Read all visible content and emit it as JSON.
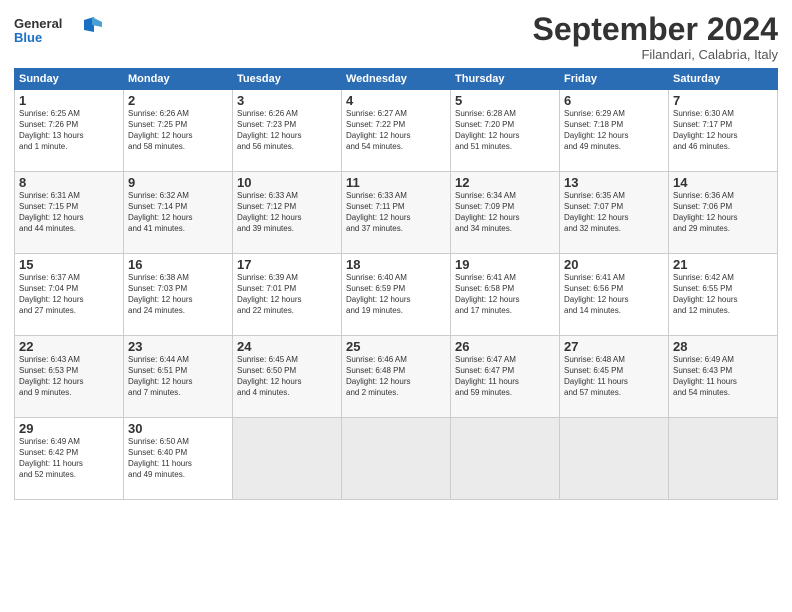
{
  "header": {
    "logo_general": "General",
    "logo_blue": "Blue",
    "month_title": "September 2024",
    "location": "Filandari, Calabria, Italy"
  },
  "weekdays": [
    "Sunday",
    "Monday",
    "Tuesday",
    "Wednesday",
    "Thursday",
    "Friday",
    "Saturday"
  ],
  "weeks": [
    [
      {
        "day": "1",
        "info": "Sunrise: 6:25 AM\nSunset: 7:26 PM\nDaylight: 13 hours\nand 1 minute."
      },
      {
        "day": "2",
        "info": "Sunrise: 6:26 AM\nSunset: 7:25 PM\nDaylight: 12 hours\nand 58 minutes."
      },
      {
        "day": "3",
        "info": "Sunrise: 6:26 AM\nSunset: 7:23 PM\nDaylight: 12 hours\nand 56 minutes."
      },
      {
        "day": "4",
        "info": "Sunrise: 6:27 AM\nSunset: 7:22 PM\nDaylight: 12 hours\nand 54 minutes."
      },
      {
        "day": "5",
        "info": "Sunrise: 6:28 AM\nSunset: 7:20 PM\nDaylight: 12 hours\nand 51 minutes."
      },
      {
        "day": "6",
        "info": "Sunrise: 6:29 AM\nSunset: 7:18 PM\nDaylight: 12 hours\nand 49 minutes."
      },
      {
        "day": "7",
        "info": "Sunrise: 6:30 AM\nSunset: 7:17 PM\nDaylight: 12 hours\nand 46 minutes."
      }
    ],
    [
      {
        "day": "8",
        "info": "Sunrise: 6:31 AM\nSunset: 7:15 PM\nDaylight: 12 hours\nand 44 minutes."
      },
      {
        "day": "9",
        "info": "Sunrise: 6:32 AM\nSunset: 7:14 PM\nDaylight: 12 hours\nand 41 minutes."
      },
      {
        "day": "10",
        "info": "Sunrise: 6:33 AM\nSunset: 7:12 PM\nDaylight: 12 hours\nand 39 minutes."
      },
      {
        "day": "11",
        "info": "Sunrise: 6:33 AM\nSunset: 7:11 PM\nDaylight: 12 hours\nand 37 minutes."
      },
      {
        "day": "12",
        "info": "Sunrise: 6:34 AM\nSunset: 7:09 PM\nDaylight: 12 hours\nand 34 minutes."
      },
      {
        "day": "13",
        "info": "Sunrise: 6:35 AM\nSunset: 7:07 PM\nDaylight: 12 hours\nand 32 minutes."
      },
      {
        "day": "14",
        "info": "Sunrise: 6:36 AM\nSunset: 7:06 PM\nDaylight: 12 hours\nand 29 minutes."
      }
    ],
    [
      {
        "day": "15",
        "info": "Sunrise: 6:37 AM\nSunset: 7:04 PM\nDaylight: 12 hours\nand 27 minutes."
      },
      {
        "day": "16",
        "info": "Sunrise: 6:38 AM\nSunset: 7:03 PM\nDaylight: 12 hours\nand 24 minutes."
      },
      {
        "day": "17",
        "info": "Sunrise: 6:39 AM\nSunset: 7:01 PM\nDaylight: 12 hours\nand 22 minutes."
      },
      {
        "day": "18",
        "info": "Sunrise: 6:40 AM\nSunset: 6:59 PM\nDaylight: 12 hours\nand 19 minutes."
      },
      {
        "day": "19",
        "info": "Sunrise: 6:41 AM\nSunset: 6:58 PM\nDaylight: 12 hours\nand 17 minutes."
      },
      {
        "day": "20",
        "info": "Sunrise: 6:41 AM\nSunset: 6:56 PM\nDaylight: 12 hours\nand 14 minutes."
      },
      {
        "day": "21",
        "info": "Sunrise: 6:42 AM\nSunset: 6:55 PM\nDaylight: 12 hours\nand 12 minutes."
      }
    ],
    [
      {
        "day": "22",
        "info": "Sunrise: 6:43 AM\nSunset: 6:53 PM\nDaylight: 12 hours\nand 9 minutes."
      },
      {
        "day": "23",
        "info": "Sunrise: 6:44 AM\nSunset: 6:51 PM\nDaylight: 12 hours\nand 7 minutes."
      },
      {
        "day": "24",
        "info": "Sunrise: 6:45 AM\nSunset: 6:50 PM\nDaylight: 12 hours\nand 4 minutes."
      },
      {
        "day": "25",
        "info": "Sunrise: 6:46 AM\nSunset: 6:48 PM\nDaylight: 12 hours\nand 2 minutes."
      },
      {
        "day": "26",
        "info": "Sunrise: 6:47 AM\nSunset: 6:47 PM\nDaylight: 11 hours\nand 59 minutes."
      },
      {
        "day": "27",
        "info": "Sunrise: 6:48 AM\nSunset: 6:45 PM\nDaylight: 11 hours\nand 57 minutes."
      },
      {
        "day": "28",
        "info": "Sunrise: 6:49 AM\nSunset: 6:43 PM\nDaylight: 11 hours\nand 54 minutes."
      }
    ],
    [
      {
        "day": "29",
        "info": "Sunrise: 6:49 AM\nSunset: 6:42 PM\nDaylight: 11 hours\nand 52 minutes."
      },
      {
        "day": "30",
        "info": "Sunrise: 6:50 AM\nSunset: 6:40 PM\nDaylight: 11 hours\nand 49 minutes."
      },
      {
        "day": "",
        "info": ""
      },
      {
        "day": "",
        "info": ""
      },
      {
        "day": "",
        "info": ""
      },
      {
        "day": "",
        "info": ""
      },
      {
        "day": "",
        "info": ""
      }
    ]
  ]
}
